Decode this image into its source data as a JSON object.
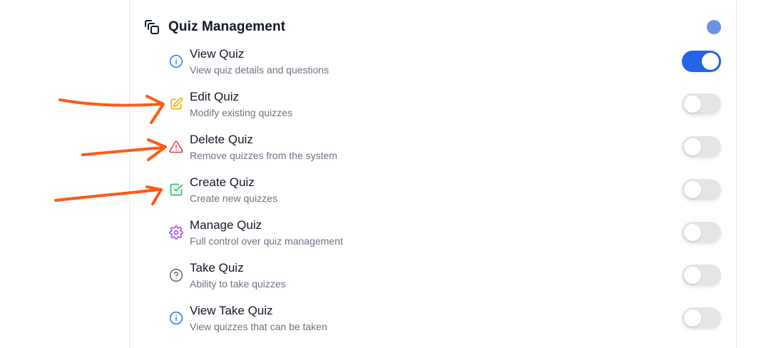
{
  "section": {
    "title": "Quiz Management",
    "icon": "group-icon",
    "status_color": "#6b93e6"
  },
  "permissions": [
    {
      "title": "View Quiz",
      "description": "View quiz details and questions",
      "icon": "info-icon",
      "icon_color": "#3b82f6",
      "enabled": true
    },
    {
      "title": "Edit Quiz",
      "description": "Modify existing quizzes",
      "icon": "edit-icon",
      "icon_color": "#eab308",
      "enabled": false
    },
    {
      "title": "Delete Quiz",
      "description": "Remove quizzes from the system",
      "icon": "warning-icon",
      "icon_color": "#ef4444",
      "enabled": false
    },
    {
      "title": "Create Quiz",
      "description": "Create new quizzes",
      "icon": "check-square-icon",
      "icon_color": "#22c55e",
      "enabled": false
    },
    {
      "title": "Manage Quiz",
      "description": "Full control over quiz management",
      "icon": "gear-icon",
      "icon_color": "#a855f7",
      "enabled": false
    },
    {
      "title": "Take Quiz",
      "description": "Ability to take quizzes",
      "icon": "help-circle-icon",
      "icon_color": "#6b7280",
      "enabled": false
    },
    {
      "title": "View Take Quiz",
      "description": "View quizzes that can be taken",
      "icon": "info-icon",
      "icon_color": "#3b82f6",
      "enabled": false
    }
  ],
  "toggle_on_color": "#2563eb",
  "annotation_color": "#ff5a14"
}
